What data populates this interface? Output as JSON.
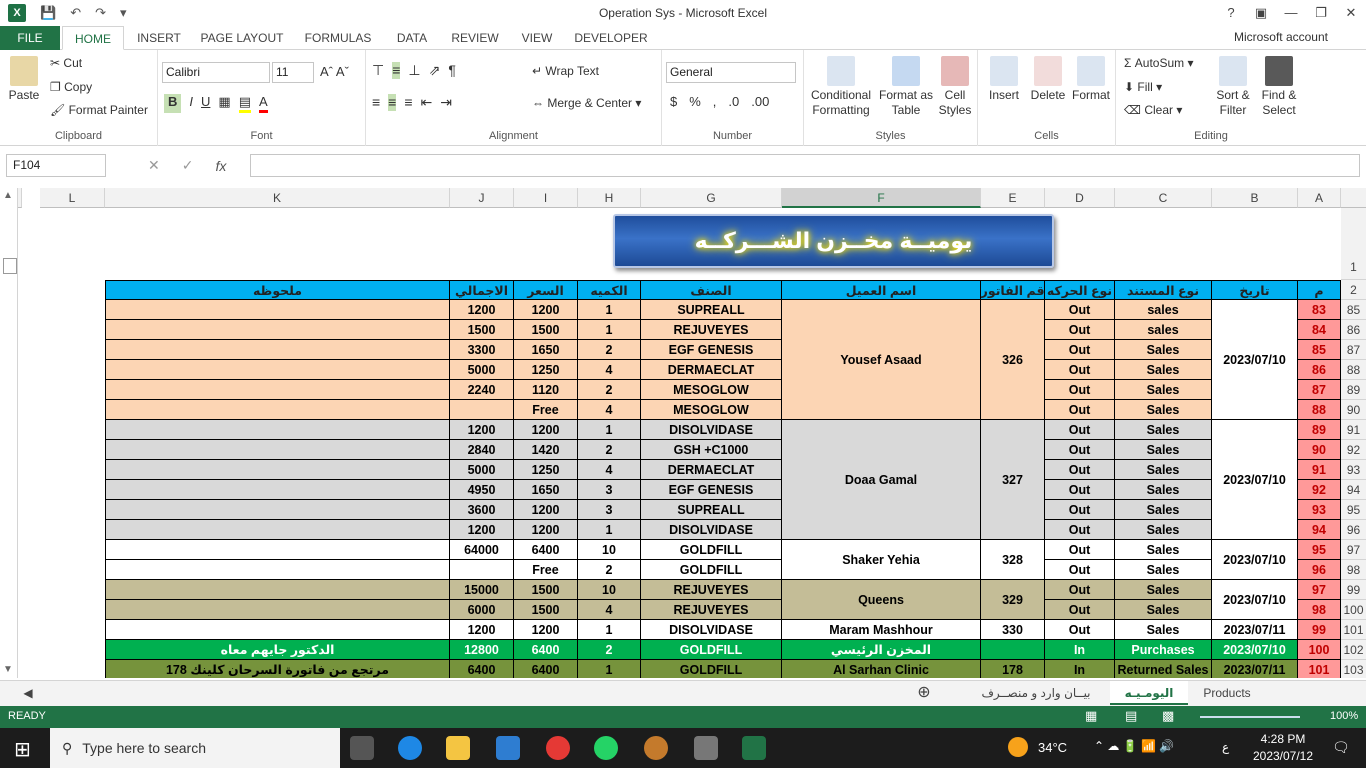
{
  "title_bar": {
    "title": "Operation Sys - Microsoft Excel",
    "app_icon": "X"
  },
  "quick_access": {
    "save": "save-icon",
    "undo": "undo-icon",
    "redo": "redo-icon",
    "customize": "customize-icon"
  },
  "window_controls": {
    "help": "?",
    "restore_ribbon": "▣",
    "minimize": "—",
    "maximize": "❐",
    "close": "✕"
  },
  "ribbon_tabs": [
    "FILE",
    "HOME",
    "INSERT",
    "PAGE LAYOUT",
    "FORMULAS",
    "DATA",
    "REVIEW",
    "VIEW",
    "DEVELOPER"
  ],
  "account": "Microsoft account",
  "ribbon": {
    "clipboard": {
      "paste": "Paste",
      "cut": "Cut",
      "copy": "Copy",
      "format_painter": "Format Painter",
      "label": "Clipboard"
    },
    "font": {
      "name": "Calibri",
      "size": "11",
      "label": "Font"
    },
    "alignment": {
      "wrap": "Wrap Text",
      "merge": "Merge & Center",
      "label": "Alignment"
    },
    "number": {
      "format": "General",
      "label": "Number"
    },
    "styles": {
      "cond": "Conditional Formatting",
      "table": "Format as Table",
      "cell": "Cell Styles",
      "label": "Styles"
    },
    "cells": {
      "insert": "Insert",
      "delete": "Delete",
      "format": "Format",
      "label": "Cells"
    },
    "editing": {
      "autosum": "AutoSum",
      "fill": "Fill",
      "clear": "Clear",
      "sort": "Sort & Filter",
      "find": "Find & Select",
      "label": "Editing"
    }
  },
  "formula_bar": {
    "name_box": "F104",
    "fx": "fx",
    "value": ""
  },
  "columns": [
    "A",
    "B",
    "C",
    "D",
    "E",
    "F",
    "G",
    "H",
    "I",
    "J",
    "K",
    "L"
  ],
  "selected_column": "F",
  "banner_title": "يوميــة مخــزن الشـــركــه",
  "headers": [
    "م",
    "تاريخ",
    "نوع المستند",
    "نوع الحركه",
    "رقم الفاتوره",
    "اسم العميل",
    "الصنف",
    "الكميه",
    "السعر",
    "الاجمالي",
    "ملحوظه"
  ],
  "row_numbers": [
    "1",
    "2",
    "85",
    "86",
    "87",
    "88",
    "89",
    "90",
    "91",
    "92",
    "93",
    "94",
    "95",
    "96",
    "97",
    "98",
    "99",
    "100",
    "101",
    "102",
    "103"
  ],
  "rows": [
    {
      "m": "83",
      "item": "SUPREALL",
      "qty": "1",
      "price": "1200",
      "total": "1200",
      "doc": "sales",
      "move": "Out"
    },
    {
      "m": "84",
      "item": "REJUVEYES",
      "qty": "1",
      "price": "1500",
      "total": "1500",
      "doc": "sales",
      "move": "Out"
    },
    {
      "m": "85",
      "item": "EGF GENESIS",
      "qty": "2",
      "price": "1650",
      "total": "3300",
      "doc": "Sales",
      "move": "Out"
    },
    {
      "m": "86",
      "item": "DERMAECLAT",
      "qty": "4",
      "price": "1250",
      "total": "5000",
      "doc": "Sales",
      "move": "Out"
    },
    {
      "m": "87",
      "item": "MESOGLOW",
      "qty": "2",
      "price": "1120",
      "total": "2240",
      "doc": "Sales",
      "move": "Out"
    },
    {
      "m": "88",
      "item": "MESOGLOW",
      "qty": "4",
      "price": "Free",
      "total": "",
      "doc": "Sales",
      "move": "Out"
    },
    {
      "m": "89",
      "item": "DISOLVIDASE",
      "qty": "1",
      "price": "1200",
      "total": "1200",
      "doc": "Sales",
      "move": "Out"
    },
    {
      "m": "90",
      "item": "GSH +C1000",
      "qty": "2",
      "price": "1420",
      "total": "2840",
      "doc": "Sales",
      "move": "Out"
    },
    {
      "m": "91",
      "item": "DERMAECLAT",
      "qty": "4",
      "price": "1250",
      "total": "5000",
      "doc": "Sales",
      "move": "Out"
    },
    {
      "m": "92",
      "item": "EGF GENESIS",
      "qty": "3",
      "price": "1650",
      "total": "4950",
      "doc": "Sales",
      "move": "Out"
    },
    {
      "m": "93",
      "item": "SUPREALL",
      "qty": "3",
      "price": "1200",
      "total": "3600",
      "doc": "Sales",
      "move": "Out"
    },
    {
      "m": "94",
      "item": "DISOLVIDASE",
      "qty": "1",
      "price": "1200",
      "total": "1200",
      "doc": "Sales",
      "move": "Out"
    },
    {
      "m": "95",
      "item": "GOLDFILL",
      "qty": "10",
      "price": "6400",
      "total": "64000",
      "doc": "Sales",
      "move": "Out"
    },
    {
      "m": "96",
      "item": "GOLDFILL",
      "qty": "2",
      "price": "Free",
      "total": "",
      "doc": "Sales",
      "move": "Out"
    },
    {
      "m": "97",
      "item": "REJUVEYES",
      "qty": "10",
      "price": "1500",
      "total": "15000",
      "doc": "Sales",
      "move": "Out"
    },
    {
      "m": "98",
      "item": "REJUVEYES",
      "qty": "4",
      "price": "1500",
      "total": "6000",
      "doc": "Sales",
      "move": "Out"
    },
    {
      "m": "99",
      "item": "DISOLVIDASE",
      "qty": "1",
      "price": "1200",
      "total": "1200",
      "doc": "Sales",
      "move": "Out"
    },
    {
      "m": "100",
      "item": "GOLDFILL",
      "qty": "2",
      "price": "6400",
      "total": "12800",
      "doc": "Purchases",
      "move": "In"
    },
    {
      "m": "101",
      "item": "GOLDFILL",
      "qty": "1",
      "price": "6400",
      "total": "6400",
      "doc": "Returned Sales",
      "move": "In"
    }
  ],
  "groups": [
    {
      "customer": "Yousef Asaad",
      "invoice": "326",
      "date": "2023/07/10",
      "color": "#fcd5b4"
    },
    {
      "customer": "Doaa Gamal",
      "invoice": "327",
      "date": "2023/07/10",
      "color": "#d9d9d9"
    },
    {
      "customer": "Shaker Yehia",
      "invoice": "328",
      "date": "2023/07/10",
      "color": "#ffffff"
    },
    {
      "customer": "Queens",
      "invoice": "329",
      "date": "2023/07/10",
      "color": "#c4bd97"
    },
    {
      "customer": "Maram Mashhour",
      "invoice": "330",
      "date": "2023/07/11",
      "color": "#ffffff"
    },
    {
      "customer": "المخزن الرئيسي",
      "invoice": "",
      "date": "2023/07/10",
      "color": "#00b050"
    },
    {
      "customer": "Al Sarhan Clinic",
      "invoice": "178",
      "date": "2023/07/11",
      "color": "#76933c"
    }
  ],
  "notes": {
    "r100": "الدكتور جايهم معاه",
    "r101": "مرتجع من فاتورة السرحان كلينك 178"
  },
  "sheet_tabs": [
    "بيــان وارد و منصــرف",
    "اليومـيـه",
    "Products"
  ],
  "active_sheet": "اليومـيـه",
  "status": {
    "ready": "READY",
    "zoom": "100%"
  },
  "taskbar": {
    "search_placeholder": "Type here to search",
    "temp": "34°C",
    "time": "4:28 PM",
    "date": "2023/07/12",
    "lang": "ع"
  },
  "colors": {
    "excel_green": "#217346",
    "header_blue": "#00b0f0",
    "number_red": "#ff9999"
  }
}
